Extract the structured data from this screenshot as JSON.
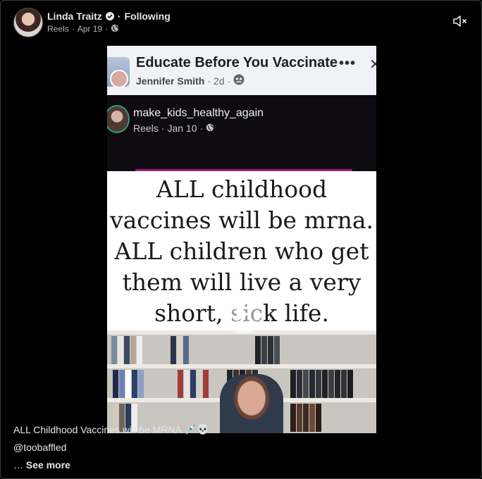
{
  "post": {
    "author": "Linda Traitz",
    "separator": "·",
    "follow_status": "Following",
    "source": "Reels",
    "date": "Apr 19",
    "meta_sep": "·"
  },
  "video": {
    "fb_group_title": "Educate Before You Vaccinate",
    "fb_group_author": "Jennifer Smith",
    "fb_group_time": "2d",
    "fb_more": "•••",
    "fb_close": "✕",
    "reel_username": "make_kids_healthy_again",
    "reel_source": "Reels",
    "reel_date": "Jan 10",
    "quote_lines": [
      "ALL childhood",
      "vaccines will be mrna.",
      "ALL children who get",
      "them will live a very",
      "short, sick life."
    ]
  },
  "caption": {
    "text": "ALL Childhood Vaccines will be MRNA",
    "emojis": "💉💀",
    "mention": "@toobaffled",
    "ellipsis": "…",
    "see_more": "See more"
  },
  "icons": {
    "verified": "verified-badge-icon",
    "globe": "globe-icon",
    "mute": "volume-muted-icon",
    "play": "play-icon"
  },
  "colors": {
    "background": "#000000",
    "text_primary": "#e4e6eb",
    "text_secondary": "#b0b3b8"
  }
}
